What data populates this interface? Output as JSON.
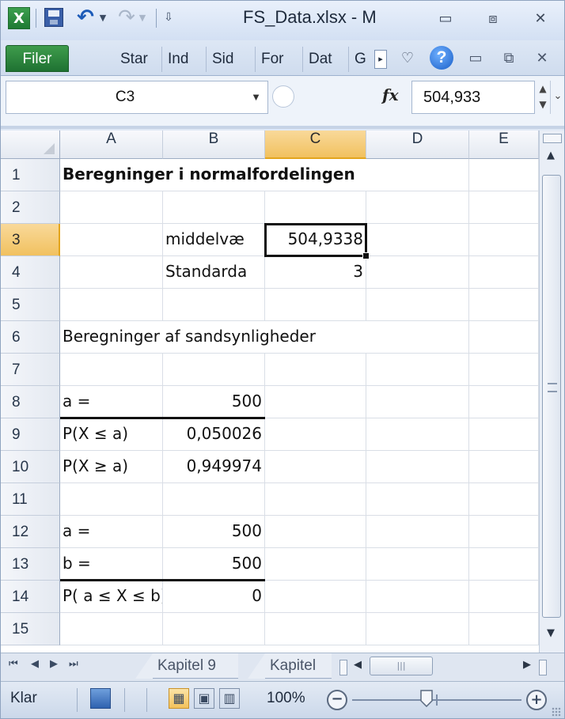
{
  "window": {
    "title": "FS_Data.xlsx - M",
    "app_icon_letter": "X",
    "accent": "#1f7232"
  },
  "ribbon": {
    "file_tab": "Filer",
    "tabs": [
      "Star",
      "Ind",
      "Sid",
      "For",
      "Dat",
      "G"
    ]
  },
  "formula_bar": {
    "name_box": "C3",
    "fx_label": "fx",
    "value": "504,933"
  },
  "columns": [
    "A",
    "B",
    "C",
    "D",
    "E"
  ],
  "selected_column": "C",
  "rows": [
    {
      "n": "1",
      "A": "Beregninger i normalfordelingen",
      "B": "",
      "C": ""
    },
    {
      "n": "2",
      "A": "",
      "B": "",
      "C": ""
    },
    {
      "n": "3",
      "A": "",
      "B": "middelvæ",
      "C": "504,9338"
    },
    {
      "n": "4",
      "A": "",
      "B": "Standarda",
      "C": "3"
    },
    {
      "n": "5",
      "A": "",
      "B": "",
      "C": ""
    },
    {
      "n": "6",
      "A": "Beregninger af sandsynligheder",
      "B": "",
      "C": ""
    },
    {
      "n": "7",
      "A": "",
      "B": "",
      "C": ""
    },
    {
      "n": "8",
      "A": "a =",
      "B": "500",
      "C": ""
    },
    {
      "n": "9",
      "A": "P(X ≤ a)",
      "B": "0,050026",
      "C": ""
    },
    {
      "n": "10",
      "A": "P(X ≥ a)",
      "B": "0,949974",
      "C": ""
    },
    {
      "n": "11",
      "A": "",
      "B": "",
      "C": ""
    },
    {
      "n": "12",
      "A": "a =",
      "B": "500",
      "C": ""
    },
    {
      "n": "13",
      "A": "b =",
      "B": "500",
      "C": ""
    },
    {
      "n": "14",
      "A": "P( a ≤ X ≤ b)",
      "B": "0",
      "C": ""
    },
    {
      "n": "15",
      "A": "",
      "B": "",
      "C": ""
    }
  ],
  "selected_row": "3",
  "sheet_tabs": [
    "Kapitel 9",
    "Kapitel"
  ],
  "status": {
    "ready": "Klar",
    "zoom": "100%"
  }
}
